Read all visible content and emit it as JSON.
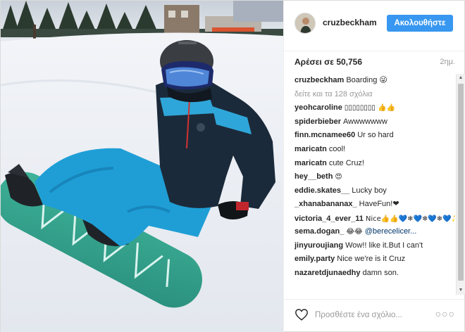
{
  "post": {
    "username": "cruzbeckham",
    "follow_label": "Ακολουθήστε",
    "likes_text": "Αρέσει σε 50,756",
    "time": "2ημ.",
    "view_all_text": "δείτε και τα 128 σχόλια"
  },
  "caption": {
    "user": "cruzbeckham",
    "text": "Boarding 😜"
  },
  "comments": [
    {
      "user": "yeohcaroline",
      "text": "▯▯▯▯▯▯▯▯ 👍👍"
    },
    {
      "user": "spiderbieber",
      "text": "Awwwwwww"
    },
    {
      "user": "finn.mcnamee60",
      "text": "Ur so hard"
    },
    {
      "user": "maricatn",
      "text": "cool!"
    },
    {
      "user": "maricatn",
      "text": "cute Cruz!"
    },
    {
      "user": "hey__beth",
      "text": "😍"
    },
    {
      "user": "eddie.skates__",
      "text": "Lucky boy"
    },
    {
      "user": "_xhanabananax_",
      "text": "HaveFun!❤"
    },
    {
      "user": "victoria_4_ever_11",
      "text": "Nice👍👍💙❄💙❄💙❄💙✨"
    },
    {
      "user": "sema.dogan_",
      "text": "😂😂",
      "mention": "@berecelicer..."
    },
    {
      "user": "jinyuroujiang",
      "text": "Wow!! like it.But I can't"
    },
    {
      "user": "emily.party",
      "text": "Nice we're is it Cruz"
    },
    {
      "user": "nazaretdjunaedhy",
      "text": "damn son."
    }
  ],
  "footer": {
    "comment_placeholder": "Προσθέστε ένα σχόλιο...",
    "more_text": "○○○"
  },
  "icons": {
    "heart": "heart-icon",
    "more": "more-options-icon"
  },
  "colors": {
    "follow_button": "#3897f0",
    "jacket": "#1b2a3a",
    "pants": "#1f9ed6",
    "snowboard": "#2e9f8a"
  }
}
